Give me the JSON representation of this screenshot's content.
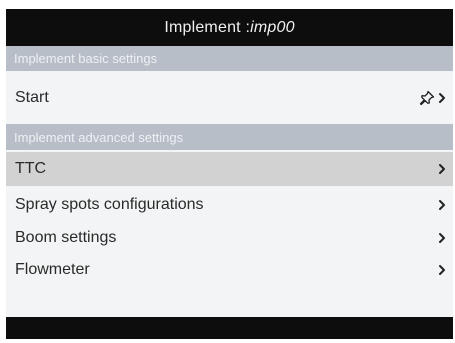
{
  "title": {
    "prefix": "Implement : ",
    "name": "imp00"
  },
  "sections": {
    "basic": "Implement basic settings",
    "advanced": "Implement advanced settings"
  },
  "rows": {
    "start": "Start",
    "ttc": "TTC",
    "spray": "Spray spots configurations",
    "boom": "Boom settings",
    "flowmeter": "Flowmeter"
  },
  "icons": {
    "start_action": "pin-icon",
    "chevron": "chevron-right-icon"
  },
  "colors": {
    "titlebar": "#0d0d0d",
    "section_header": "#b7bec7",
    "selected_row": "#d2d2d2",
    "background": "#f3f4f5"
  }
}
